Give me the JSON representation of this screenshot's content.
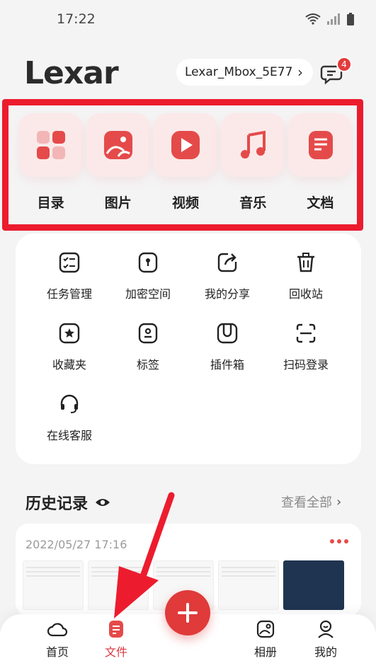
{
  "status": {
    "time": "17:22"
  },
  "header": {
    "logo_text": "Lexar",
    "device_name": "Lexar_Mbox_5E77",
    "message_count": "4"
  },
  "categories": [
    {
      "label": "目录",
      "icon": "grid-icon"
    },
    {
      "label": "图片",
      "icon": "picture-icon"
    },
    {
      "label": "视频",
      "icon": "play-icon"
    },
    {
      "label": "音乐",
      "icon": "music-note-icon"
    },
    {
      "label": "文档",
      "icon": "document-icon"
    }
  ],
  "tools": [
    {
      "label": "任务管理",
      "icon": "task-list-icon"
    },
    {
      "label": "加密空间",
      "icon": "lock-box-icon"
    },
    {
      "label": "我的分享",
      "icon": "share-icon"
    },
    {
      "label": "回收站",
      "icon": "trash-icon"
    },
    {
      "label": "收藏夹",
      "icon": "star-box-icon"
    },
    {
      "label": "标签",
      "icon": "tag-icon"
    },
    {
      "label": "插件箱",
      "icon": "plugin-icon"
    },
    {
      "label": "扫码登录",
      "icon": "scan-icon"
    },
    {
      "label": "在线客服",
      "icon": "headset-icon"
    }
  ],
  "history": {
    "title": "历史记录",
    "view_all": "查看全部",
    "date": "2022/05/27 17:16"
  },
  "bottom_nav": [
    {
      "label": "首页",
      "icon": "home-cloud-icon",
      "active": false
    },
    {
      "label": "文件",
      "icon": "file-icon",
      "active": true
    },
    {
      "label": "相册",
      "icon": "album-icon",
      "active": false
    },
    {
      "label": "我的",
      "icon": "profile-icon",
      "active": false
    }
  ],
  "colors": {
    "accent": "#e03a3a",
    "highlight": "#ec1c2e"
  }
}
